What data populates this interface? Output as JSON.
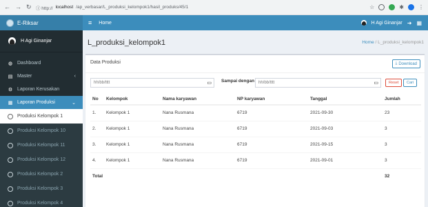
{
  "browser": {
    "url_prefix": "ⓘ http://",
    "url_host": "localhost",
    "url_path": "/ap_verbasar/L_produksi_kelompok1/hasil_produks/45/1"
  },
  "brand": {
    "name": "E-Riksar"
  },
  "sidebar": {
    "user_name": "H Agi Ginanjar",
    "items": [
      {
        "label": "Dashboard",
        "icon": "dashboard-icon"
      },
      {
        "label": "Master",
        "icon": "database-icon"
      },
      {
        "label": "Laporan Kerusakan",
        "icon": "gear-icon"
      },
      {
        "label": "Laporan Produksi",
        "icon": "table-icon"
      }
    ],
    "subitems": [
      {
        "label": "Produksi Kelompok 1"
      },
      {
        "label": "Produksi Kelompok 10"
      },
      {
        "label": "Produksi Kelompok 11"
      },
      {
        "label": "Produksi Kelompok 12"
      },
      {
        "label": "Produksi Kelompok 2"
      },
      {
        "label": "Produksi Kelompok 3"
      },
      {
        "label": "Produksi Kelompok 4"
      }
    ]
  },
  "navbar": {
    "home_label": "Home",
    "user_name": "H Agi Ginanjar"
  },
  "page": {
    "title": "L_produksi_kelompok1",
    "breadcrumb_home": "Home",
    "breadcrumb_current": "L_produksi_kelompok1"
  },
  "box": {
    "title": "Data Produksi",
    "download_label": "Download",
    "date_from_placeholder": "hh/bb/tttt",
    "until_label": "Sampai dengan",
    "date_to_placeholder": "hh/bb/tttt",
    "reset_label": "Reset",
    "search_label": "Cari"
  },
  "table": {
    "headers": [
      "No",
      "Kelompok",
      "Nama karyawan",
      "NP karyawan",
      "Tanggal",
      "Jumlah"
    ],
    "rows": [
      [
        "1.",
        "Kelompok 1",
        "Nana Rusmana",
        "6719",
        "2021-09-30",
        "23"
      ],
      [
        "2.",
        "Kelompok 1",
        "Nana Rusmana",
        "6719",
        "2021-09-03",
        "3"
      ],
      [
        "3.",
        "Kelompok 1",
        "Nana Rusmana",
        "6719",
        "2021-09-15",
        "3"
      ],
      [
        "4.",
        "Kelompok 1",
        "Nana Rusmana",
        "6719",
        "2021-09-01",
        "3"
      ]
    ],
    "total_label": "Total",
    "total_value": "32"
  },
  "colors": {
    "primary": "#3c8dbc",
    "sidebar": "#222d32",
    "danger": "#dd4b39"
  }
}
